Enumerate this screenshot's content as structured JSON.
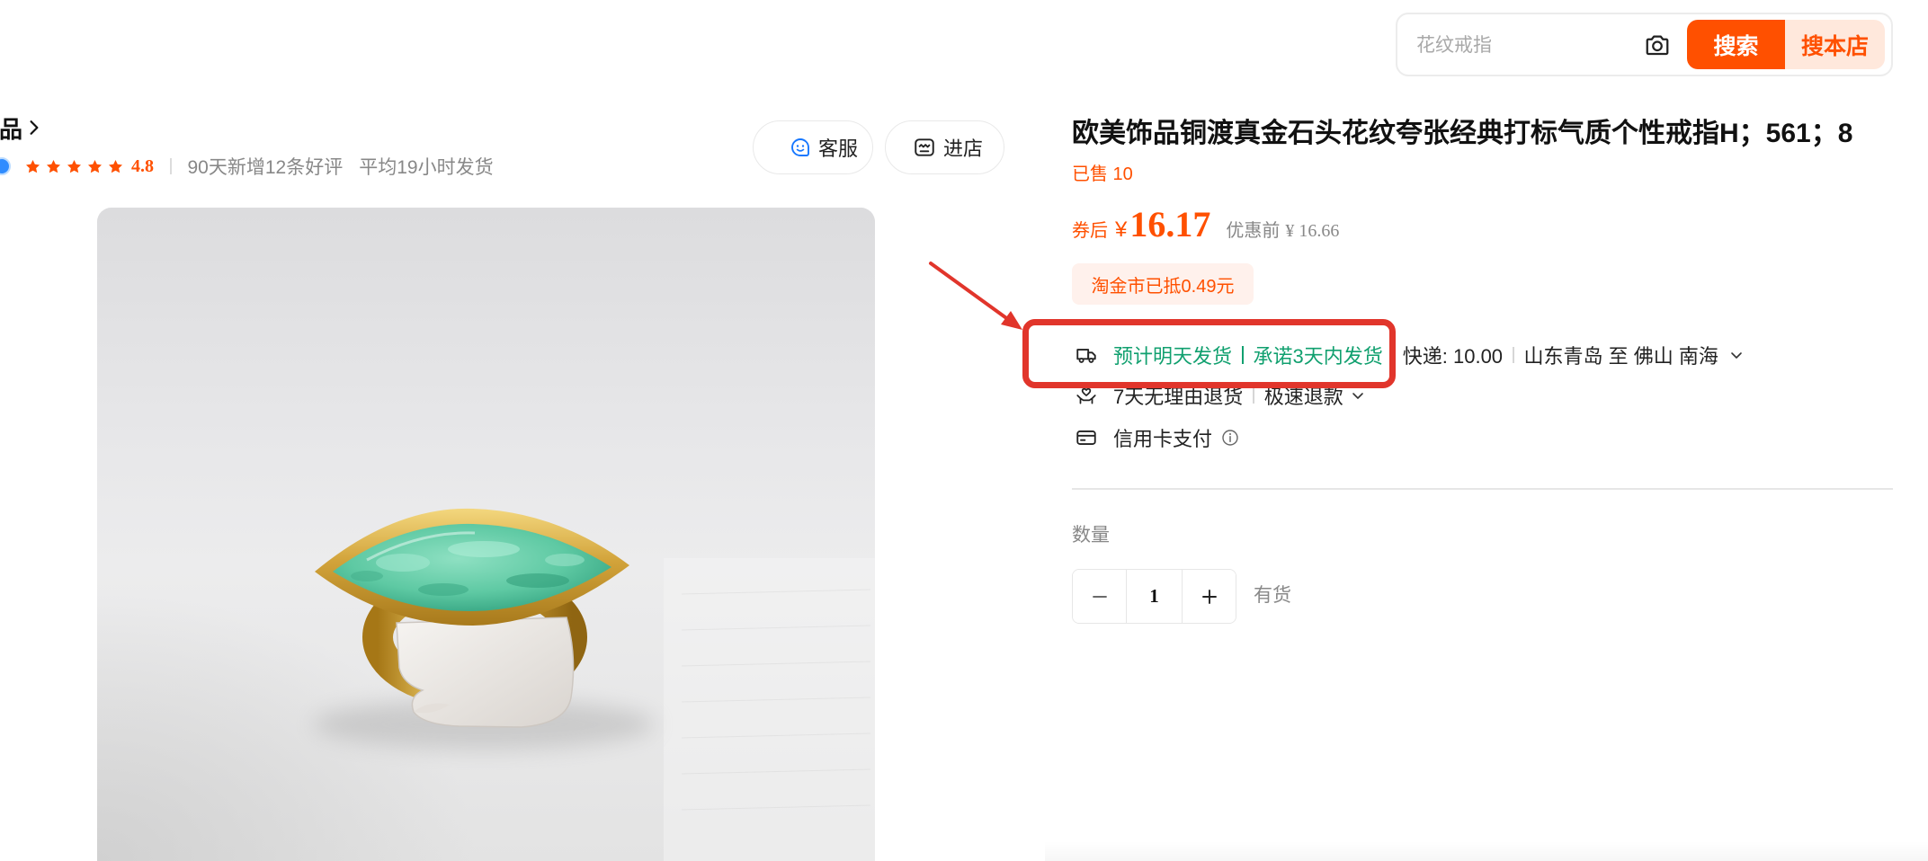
{
  "search": {
    "placeholder": "花纹戒指",
    "button": "搜索",
    "shop_button": "搜本店"
  },
  "shop": {
    "name": "饰品",
    "star_count": 5,
    "rating": "4.8",
    "new_reviews": "90天新增12条好评",
    "ship_time": "平均19小时发货",
    "service_button": "客服",
    "enter_button": "进店"
  },
  "product": {
    "title": "欧美饰品铜渡真金石头花纹夸张经典打标气质个性戒指H；561；8",
    "sold": "已售 10",
    "price_label": "券后",
    "currency": "¥",
    "price": "16.17",
    "original_label": "优惠前",
    "original_price": "¥ 16.66",
    "coupon": "淘金市已抵0.49元"
  },
  "delivery": {
    "estimate": "预计明天发货",
    "promise": "承诺3天内发货",
    "shipping_fee": "快递: 10.00",
    "route": "山东青岛 至 佛山 南海"
  },
  "services": {
    "returns": "7天无理由退货",
    "refund": "极速退款",
    "payment": "信用卡支付"
  },
  "quantity": {
    "label": "数量",
    "value": "1",
    "stock": "有货"
  },
  "colors": {
    "accent": "#ff5000",
    "delivery_green": "#11a06f",
    "annotation_red": "#e1352b",
    "coupon_bg": "#fff1ec"
  },
  "icons": {
    "image_search": "camera-icon",
    "customer_service": "service-smiley-icon",
    "enter_shop": "shop-icon",
    "delivery": "truck-icon",
    "returns": "return-icon",
    "payment": "credit-card-icon",
    "payment_info": "info-icon",
    "rating": "star-icon"
  }
}
